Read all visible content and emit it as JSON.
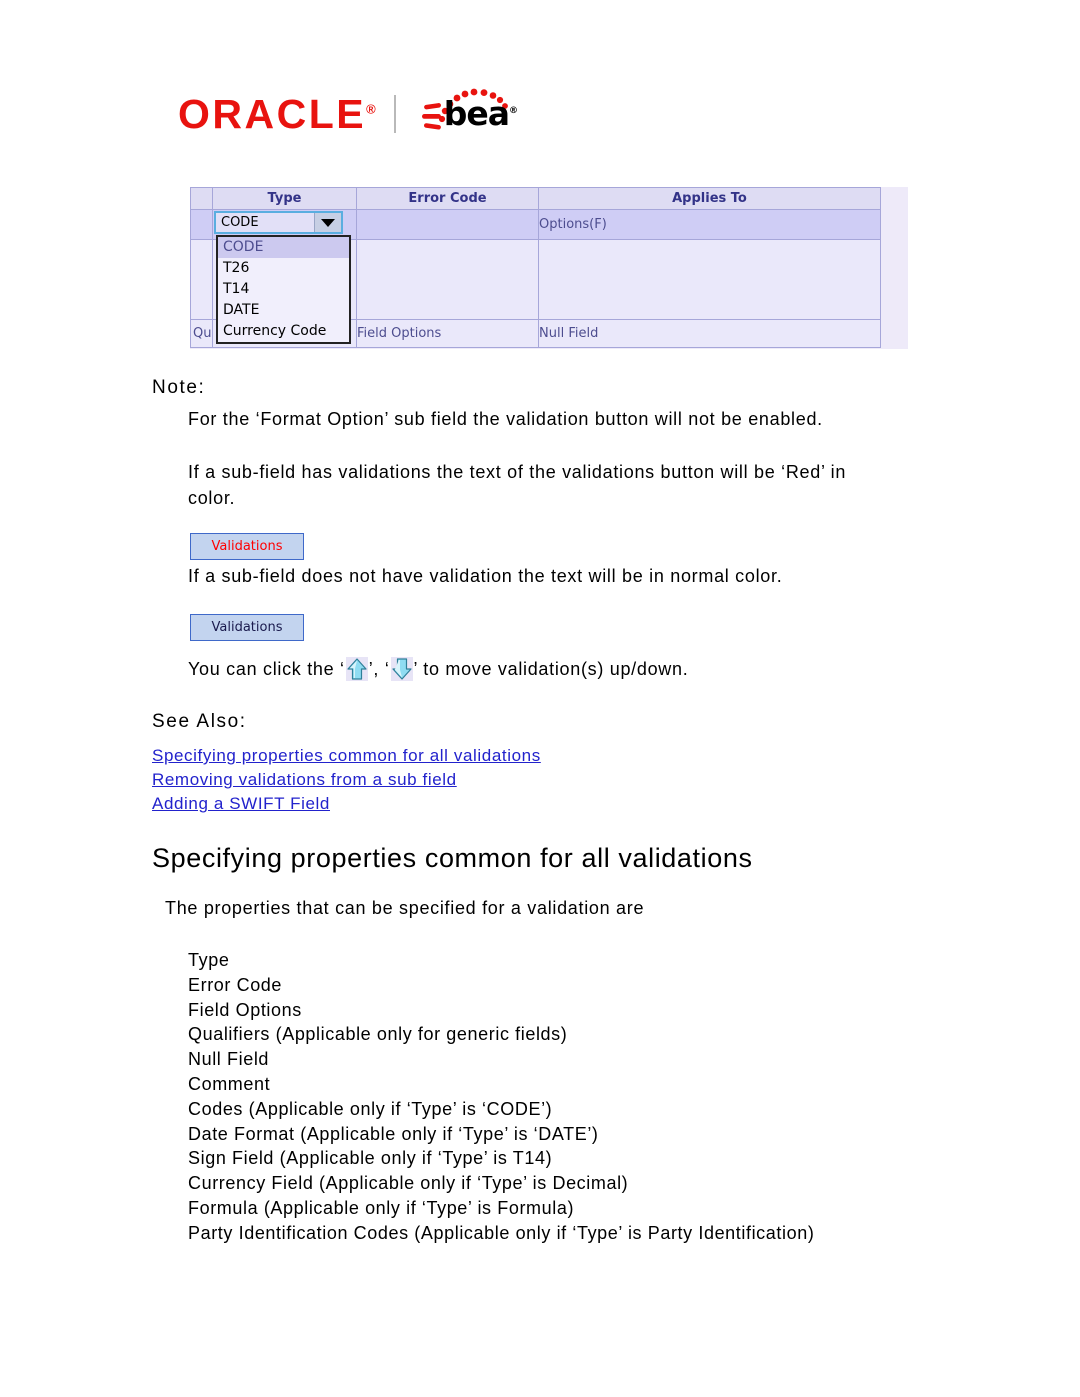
{
  "logo": {
    "oracle": "ORACLE",
    "oracle_reg": "®",
    "bea": "bea",
    "bea_reg": "®",
    "divider": "|"
  },
  "screenshot": {
    "table": {
      "columns": [
        "",
        "Type",
        "Error Code",
        "Applies To"
      ],
      "selected_row": {
        "type_value": "CODE",
        "error_code": "",
        "applies_to": "Options(F)"
      },
      "footer_row": {
        "qualifiers": "Qu",
        "field_options": "Field Options",
        "null_field": "Null Field"
      }
    },
    "dropdown": {
      "selected": "CODE",
      "options": [
        "CODE",
        "T26",
        "T14",
        "DATE",
        "Currency Code"
      ]
    },
    "colors": {
      "header_bg": "#dedcf3",
      "header_text": "#333388",
      "row_selected_bg": "#cfcdf5",
      "row_bg": "#eae8fa",
      "border": "#a6a6d9",
      "combo_focus_border": "#5aaee0"
    }
  },
  "note": {
    "label": "Note:",
    "paragraph1": "For the ‘Format Option’ sub field the validation button will not be enabled.",
    "paragraph2": "If a sub-field has validations the text of the validations button will be ‘Red’ in color.",
    "paragraph3": "If a sub-field does not have validation the text will be in normal color.",
    "paragraph4_prefix": "You can click the ‘",
    "paragraph4_mid": "’, ‘",
    "paragraph4_suffix": "’ to move validation(s) up/down."
  },
  "buttons": {
    "validations_red": "Validations",
    "validations_normal": "Validations",
    "red_color": "#ff0000",
    "normal_color": "#1a1a4d",
    "bg_color": "#c3d4ef",
    "border_color": "#3f69c9"
  },
  "icons": {
    "up_arrow": "arrow-up-icon",
    "down_arrow": "arrow-down-icon",
    "arrow_color": "#7fd4ef"
  },
  "see_also": {
    "label": "See Also:",
    "links": [
      "Specifying properties common for all validations",
      "Removing validations from a sub field",
      "Adding a SWIFT Field"
    ],
    "link_color": "#2222cc"
  },
  "section": {
    "heading": "Specifying properties common for all validations",
    "intro": "The properties that can be specified for a validation are",
    "properties": [
      "Type",
      "Error Code",
      "Field Options",
      "Qualifiers (Applicable only for generic fields)",
      "Null Field",
      "Comment",
      "Codes (Applicable only if ‘Type’ is ‘CODE’)",
      "Date Format (Applicable only if ‘Type’ is ‘DATE’)",
      "Sign Field (Applicable only if ‘Type’ is T14)",
      "Currency Field (Applicable only if ‘Type’ is Decimal)",
      "Formula (Applicable only if ‘Type’ is Formula)",
      "Party Identification Codes (Applicable only if ‘Type’ is Party Identification)"
    ]
  }
}
